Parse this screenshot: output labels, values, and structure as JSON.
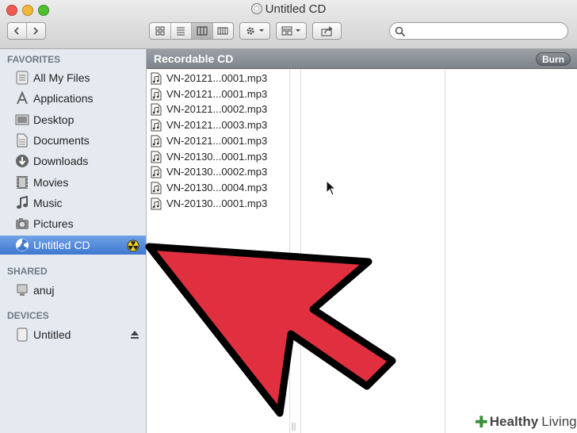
{
  "window": {
    "title": "Untitled CD"
  },
  "sidebar": {
    "favorites_header": "FAVORITES",
    "favorites": [
      {
        "label": "All My Files",
        "icon": "all-files-icon"
      },
      {
        "label": "Applications",
        "icon": "applications-icon"
      },
      {
        "label": "Desktop",
        "icon": "desktop-icon"
      },
      {
        "label": "Documents",
        "icon": "documents-icon"
      },
      {
        "label": "Downloads",
        "icon": "downloads-icon"
      },
      {
        "label": "Movies",
        "icon": "movies-icon"
      },
      {
        "label": "Music",
        "icon": "music-icon"
      },
      {
        "label": "Pictures",
        "icon": "pictures-icon"
      },
      {
        "label": "Untitled CD",
        "icon": "burn-cd-icon",
        "selected": true
      }
    ],
    "shared_header": "SHARED",
    "shared": [
      {
        "label": "anuj",
        "icon": "computer-icon"
      }
    ],
    "devices_header": "DEVICES",
    "devices": [
      {
        "label": "Untitled",
        "icon": "drive-icon"
      }
    ]
  },
  "content": {
    "path_label": "Recordable CD",
    "burn_button": "Burn",
    "files": [
      "VN-20121...0001.mp3",
      "VN-20121...0001.mp3",
      "VN-20121...0002.mp3",
      "VN-20121...0003.mp3",
      "VN-20121...0001.mp3",
      "VN-20130...0001.mp3",
      "VN-20130...0002.mp3",
      "VN-20130...0004.mp3",
      "VN-20130...0001.mp3"
    ]
  },
  "watermark": {
    "bold": "Healthy",
    "rest": "Living"
  },
  "colors": {
    "selection": "#3f78cf",
    "sidebar_bg": "#e5eaf0",
    "arrow": "#e03040"
  }
}
